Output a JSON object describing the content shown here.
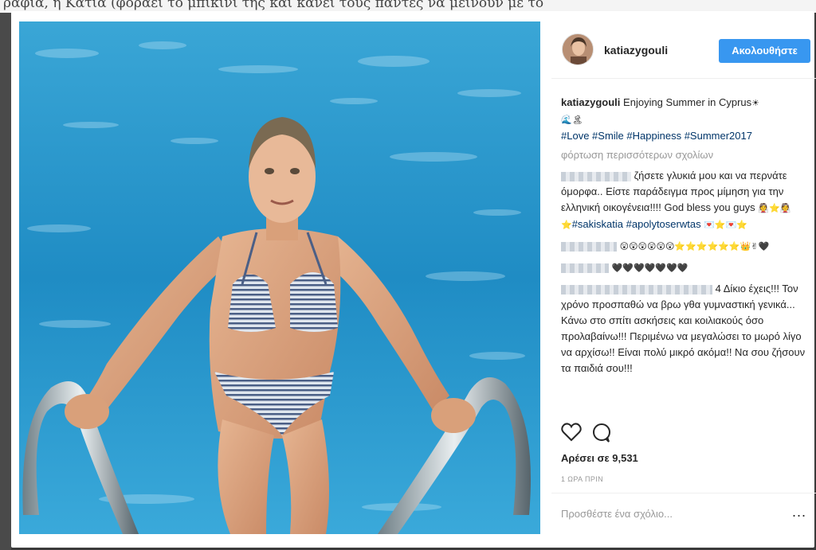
{
  "background": {
    "article_text": "ραφία, η Κάτια (φοράει το μπικίνι της και κάνει τους πάντες να μείνουν με το"
  },
  "post": {
    "username": "katiazygouli",
    "follow_label": "Ακολουθήστε",
    "caption_text": "Enjoying Summer in Cyprus",
    "caption_emoji": "☀",
    "caption_emoji_line2": "🌊🏝",
    "hashtags": [
      "#Love",
      "#Smile",
      "#Happiness",
      "#Summer2017"
    ],
    "load_more_label": "φόρτωση περισσότερων σχολίων",
    "comments": [
      {
        "text": "ζήσετε γλυκιά μου και να περνάτε όμορφα.. Είστε παράδειγμα προς μίμηση για την ελληνική οικογένεια!!!! God bless you guys",
        "emoji": "👰⭐👰⭐",
        "tags": [
          "#sakiskatia",
          "#apolytoserwtas"
        ],
        "trailing_emoji": "💌⭐💌⭐"
      },
      {
        "emoji": "😲😲😲😲😲😲⭐⭐⭐⭐⭐⭐👑✌🖤"
      },
      {
        "emoji": "🖤🖤🖤🖤🖤🖤🖤"
      },
      {
        "text_start": "4 Δίκιο έχεις!!! Τον χρόνο προσπαθώ να βρω γθα γυμναστική γενικά... Κάνω στο σπίτι ασκήσεις και κοιλιακούς όσο προλαβαίνω!!! Περιμένω να μεγαλώσει το μωρό λίγο να αρχίσω!! Είναι πολύ μικρό ακόμα!! Να σου ζήσουν τα παιδιά σου!!!"
      }
    ],
    "likes_label": "Αρέσει σε 9,531",
    "time_label": "1 ΩΡΑ ΠΡΙΝ",
    "add_comment_placeholder": "Προσθέστε ένα σχόλιο...",
    "more_options": "...",
    "accent_color": "#3897f0"
  }
}
